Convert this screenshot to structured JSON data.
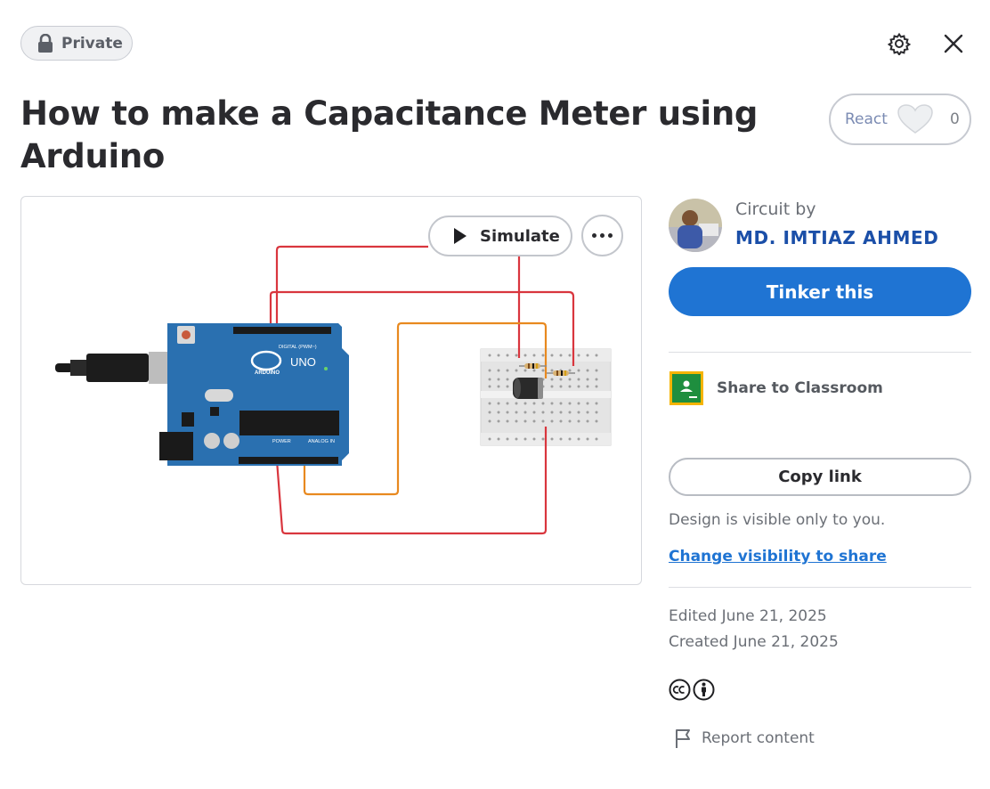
{
  "header": {
    "privacy_badge": "Private",
    "privacy_icon": "lock-icon",
    "settings_icon": "gear-icon",
    "close_icon": "close-icon"
  },
  "title": "How to make a Capacitance Meter using Arduino",
  "reactions": {
    "label": "React",
    "count": "0",
    "icon": "heart-icon"
  },
  "preview": {
    "simulate_label": "Simulate",
    "more_icon": "more-icon",
    "board": {
      "logo_text": "UNO",
      "brand_text": "ARDUINO",
      "digital_label": "DIGITAL (PWM~)",
      "power_label": "POWER",
      "analog_label": "ANALOG IN"
    }
  },
  "author": {
    "caption": "Circuit by",
    "name": "MD. IMTIAZ AHMED"
  },
  "actions": {
    "tinker_label": "Tinker this",
    "classroom_label": "Share to Classroom",
    "copy_link_label": "Copy link"
  },
  "visibility": {
    "note": "Design is visible only to you.",
    "link": "Change visibility to share"
  },
  "dates": {
    "edited": "Edited June 21, 2025",
    "created": "Created June 21, 2025"
  },
  "license_icons": [
    "cc-icon",
    "by-icon"
  ],
  "report_label": "Report content",
  "colors": {
    "accent": "#1f74d3",
    "author": "#1b4fa8",
    "wire_red": "#d9363e",
    "wire_orange": "#e8891f",
    "board_blue": "#2a70b0"
  }
}
